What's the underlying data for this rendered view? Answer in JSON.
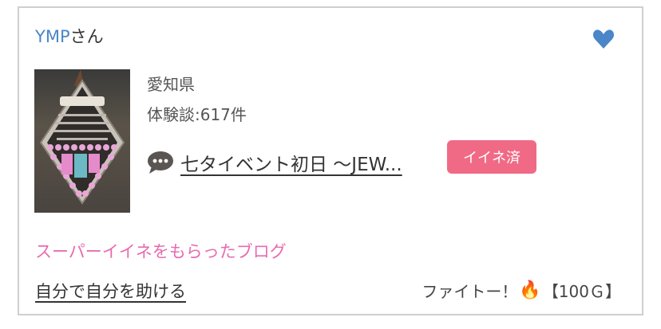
{
  "user": {
    "name": "YMP",
    "suffix": "さん"
  },
  "profile": {
    "prefecture": "愛知県",
    "experience_count": "体験談:617件"
  },
  "blog": {
    "title": "七タイベント初日 〜JEW...",
    "iine_label": "イイネ済"
  },
  "super_iine_label": "スーパーイイネをもらったブログ",
  "footer": {
    "left_text": "自分で自分を助ける",
    "right_text": "ファイトー！",
    "fire": "🔥",
    "points": "【100Ｇ】"
  },
  "colors": {
    "user_name": "#4a86c8",
    "heart": "#4a86c8",
    "iine_bg": "#f06a86",
    "super_label": "#e86bb0"
  },
  "icons": {
    "heart": "heart-icon",
    "comment": "speech-bubble-icon",
    "fire": "fire-icon"
  }
}
